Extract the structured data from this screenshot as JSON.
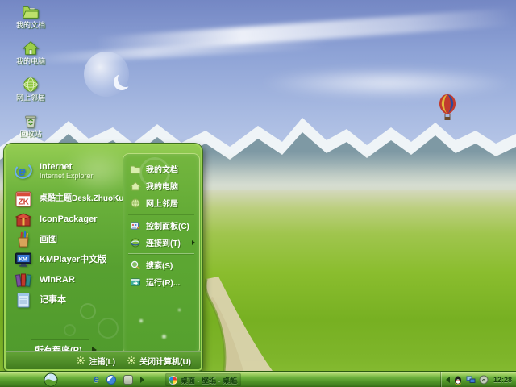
{
  "colors": {
    "menu_green": "#57a030",
    "menu_border": "#9ed455",
    "taskbar_green": "#4f9428",
    "text_white": "#ffffff",
    "task_text_dark": "#123f0a",
    "balloon_stripes": [
      "#c23b2e",
      "#e0b83a",
      "#2c4a9e"
    ]
  },
  "desktop": {
    "icons": [
      {
        "label": "我的文档",
        "icon": "my-documents-icon"
      },
      {
        "label": "我的电脑",
        "icon": "my-computer-icon"
      },
      {
        "label": "网上邻居",
        "icon": "network-places-icon"
      },
      {
        "label": "回收站",
        "icon": "recycle-bin-icon"
      }
    ]
  },
  "start_menu": {
    "pinned": [
      {
        "title": "Internet",
        "subtitle": "Internet Explorer",
        "icon": "internet-explorer-icon"
      },
      {
        "title": "桌酷主题Desk.ZhuoKu.Com",
        "icon": "zhuoku-theme-icon"
      },
      {
        "title": "IconPackager",
        "icon": "iconpackager-icon"
      },
      {
        "title": "画图",
        "icon": "paint-icon"
      },
      {
        "title": "KMPlayer中文版",
        "icon": "kmplayer-icon"
      },
      {
        "title": "WinRAR",
        "icon": "winrar-icon"
      },
      {
        "title": "记事本",
        "icon": "notepad-icon"
      }
    ],
    "all_programs": "所有程序(P)",
    "places": [
      {
        "label": "我的文档",
        "icon": "my-documents-icon"
      },
      {
        "label": "我的电脑",
        "icon": "my-computer-icon"
      },
      {
        "label": "网上邻居",
        "icon": "network-places-icon"
      }
    ],
    "system": [
      {
        "label": "控制面板(C)",
        "icon": "control-panel-icon"
      },
      {
        "label": "连接到(T)",
        "icon": "connect-to-icon",
        "submenu": true
      }
    ],
    "actions": [
      {
        "label": "搜索(S)",
        "icon": "search-icon"
      },
      {
        "label": "运行(R)...",
        "icon": "run-icon"
      }
    ],
    "log_off": "注销(L)",
    "shut_down": "关闭计算机(U)"
  },
  "taskbar": {
    "task_button": "桌面 - 壁纸 - 桌酷...",
    "clock": "12:28"
  }
}
